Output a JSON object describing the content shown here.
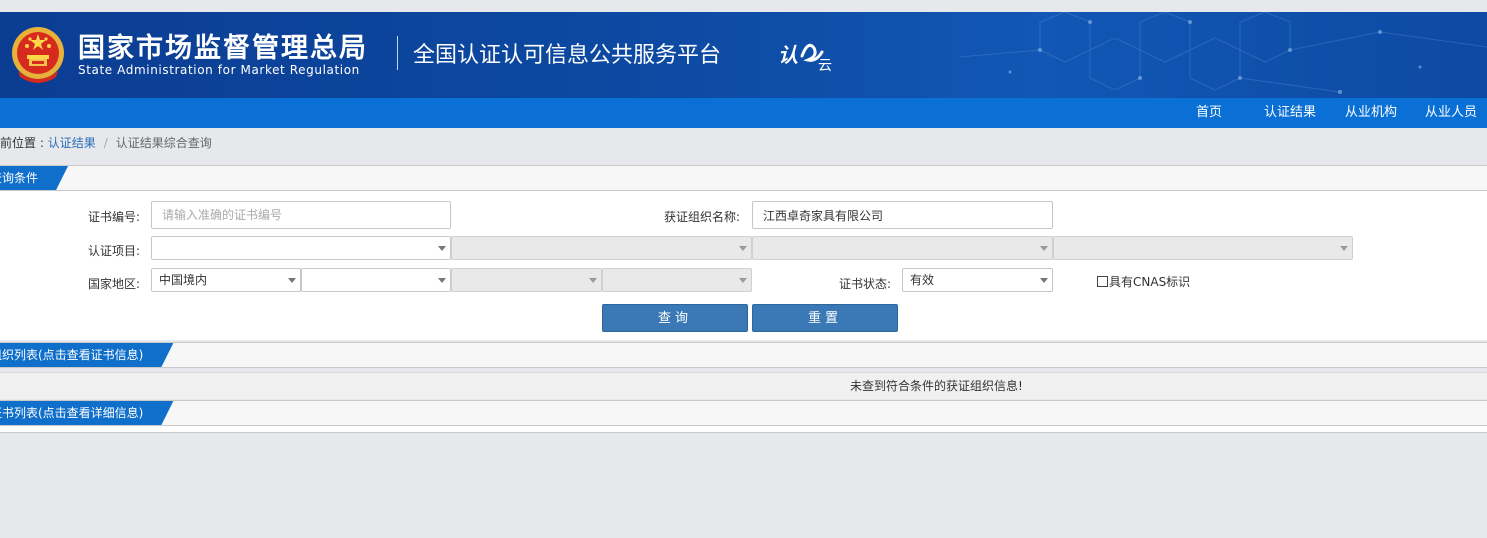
{
  "header": {
    "org_name_cn": "国家市场监督管理总局",
    "org_name_en": "State Administration  for  Market Regulation",
    "platform_title": "全国认证认可信息公共服务平台",
    "brand_mark_text": "认e云",
    "emblem": "national-emblem-icon",
    "colors": {
      "header_blue": "#0d4aa3",
      "nav_blue": "#0a70d6"
    }
  },
  "nav": {
    "items": [
      "首页",
      "认证结果",
      "从业机构",
      "从业人员"
    ]
  },
  "breadcrumb": {
    "prefix": "当前位置 : ",
    "link": "认证结果",
    "separator": "/",
    "current": "认证结果综合查询"
  },
  "query": {
    "section_title": "查询条件",
    "cert_no_label": "证书编号:",
    "cert_no_placeholder": "请输入准确的证书编号",
    "cert_no_value": "",
    "org_name_label": "获证组织名称:",
    "org_name_value": "江西卓奇家具有限公司",
    "project_label": "认证项目:",
    "project_selects": [
      "",
      "",
      "",
      ""
    ],
    "region_label": "国家地区:",
    "region_selects": [
      "中国境内",
      "",
      "",
      ""
    ],
    "status_label": "证书状态:",
    "status_value": "有效",
    "cnas_label": "具有CNAS标识",
    "cnas_checked": false,
    "search_button": "查询",
    "reset_button": "重置"
  },
  "org_list": {
    "section_title": "组织列表(点击查看证书信息)",
    "empty_message": "未查到符合条件的获证组织信息!"
  },
  "cert_list": {
    "section_title": "证书列表(点击查看详细信息)"
  }
}
